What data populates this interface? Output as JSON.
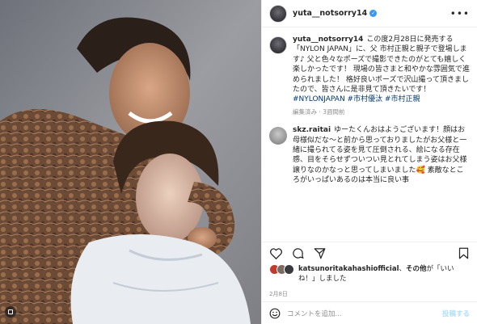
{
  "post": {
    "username": "yuta__notsorry14",
    "more_icon": "more-horizontal-icon",
    "verified_icon": "verified-badge-icon"
  },
  "caption": {
    "username": "yuta__notsorry14",
    "text": "この度2月28日に発売する「NYLON JAPAN」に、父 市村正親と親子で登場します♪ 父と色々なポーズで撮影できたのがとても嬉しく楽しかったです！ 現場の皆さまと和やかな雰囲気で進められました！ 格好良いポーズで沢山撮って頂きましたので、皆さんに是非見て頂きたいです！",
    "hashtags": "#NYLONJAPAN #市村優汰 #市村正親",
    "meta": "編集済み · 3週間前"
  },
  "comment": {
    "username": "skz.raitai",
    "text": "ゆーたくんおはようございます！顔はお母様似だな〜と前から思っておりましたがお父様と一緒に撮られてる姿を見て圧倒される、絵になる存在感、目をそらせずついつい見とれてしまう姿はお父様譲りなのかなっと思ってしまいました🥰 素敵なところがいっぱいあるのは本当に良い事"
  },
  "actions": {
    "like_icon": "heart-icon",
    "comment_icon": "comment-icon",
    "share_icon": "share-icon",
    "save_icon": "bookmark-icon"
  },
  "likes": {
    "user": "katsunoritakahashiofficial",
    "middle": "、",
    "bold2": "その他",
    "suffix": "が「いいね！」しました"
  },
  "date": "2月8日",
  "add_comment": {
    "placeholder": "コメントを追加...",
    "post_label": "投稿する",
    "emoji_icon": "emoji-icon"
  },
  "colors": {
    "accent": "#3897f0",
    "link": "#00376b",
    "post_disabled": "#b2dffc"
  }
}
